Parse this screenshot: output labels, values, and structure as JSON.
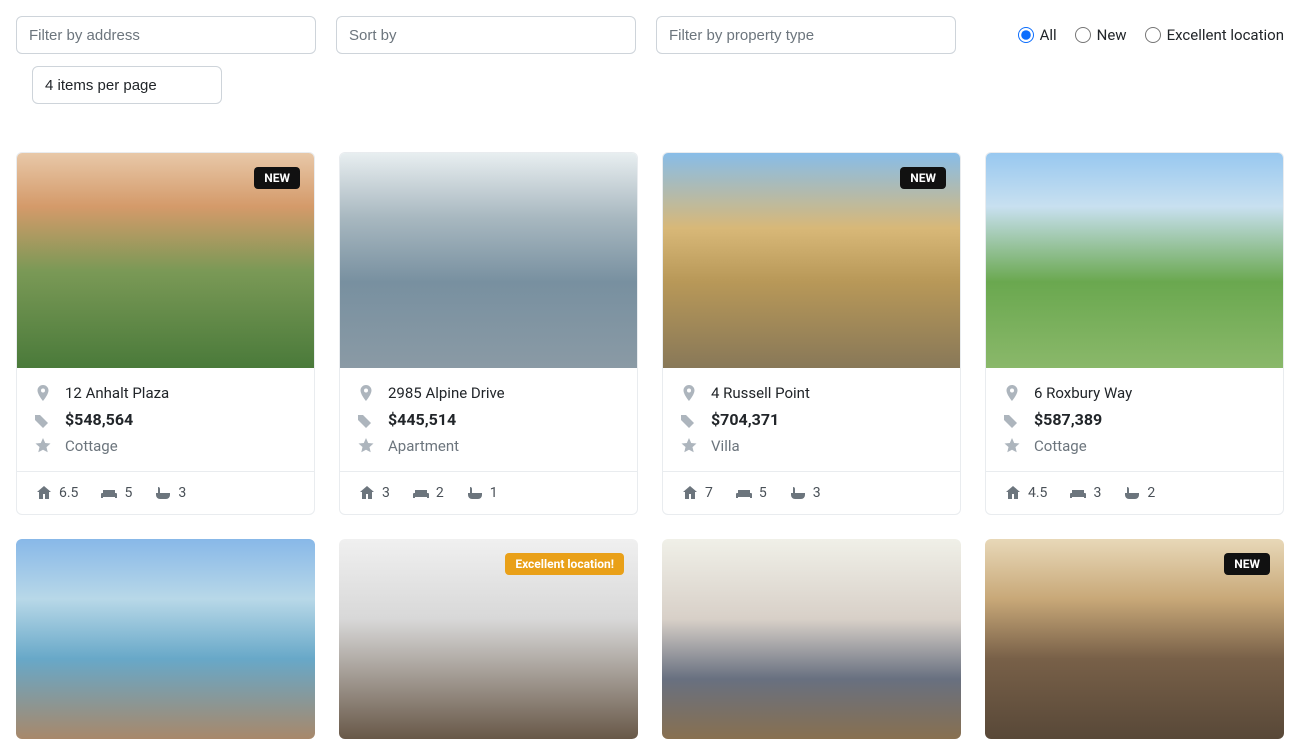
{
  "filters": {
    "address_placeholder": "Filter by address",
    "sort_placeholder": "Sort by",
    "type_placeholder": "Filter by property type",
    "items_per_page_label": "4 items per page",
    "radios": {
      "all": "All",
      "new": "New",
      "excellent": "Excellent location"
    },
    "selected_radio": "all"
  },
  "badges": {
    "new": "NEW",
    "excellent": "Excellent location!"
  },
  "listings": [
    {
      "address": "12 Anhalt Plaza",
      "price": "$548,564",
      "type": "Cottage",
      "badge": "new",
      "stats": {
        "area": "6.5",
        "sofa": "5",
        "bath": "3"
      },
      "img": "img1"
    },
    {
      "address": "2985 Alpine Drive",
      "price": "$445,514",
      "type": "Apartment",
      "badge": null,
      "stats": {
        "area": "3",
        "sofa": "2",
        "bath": "1"
      },
      "img": "img2"
    },
    {
      "address": "4 Russell Point",
      "price": "$704,371",
      "type": "Villa",
      "badge": "new",
      "stats": {
        "area": "7",
        "sofa": "5",
        "bath": "3"
      },
      "img": "img3"
    },
    {
      "address": "6 Roxbury Way",
      "price": "$587,389",
      "type": "Cottage",
      "badge": null,
      "stats": {
        "area": "4.5",
        "sofa": "3",
        "bath": "2"
      },
      "img": "img4"
    },
    {
      "address": "",
      "price": "",
      "type": "",
      "badge": null,
      "stats": {
        "area": "",
        "sofa": "",
        "bath": ""
      },
      "img": "img5"
    },
    {
      "address": "",
      "price": "",
      "type": "",
      "badge": "excellent",
      "stats": {
        "area": "",
        "sofa": "",
        "bath": ""
      },
      "img": "img6"
    },
    {
      "address": "",
      "price": "",
      "type": "",
      "badge": null,
      "stats": {
        "area": "",
        "sofa": "",
        "bath": ""
      },
      "img": "img7"
    },
    {
      "address": "",
      "price": "",
      "type": "",
      "badge": "new",
      "stats": {
        "area": "",
        "sofa": "",
        "bath": ""
      },
      "img": "img8"
    }
  ]
}
